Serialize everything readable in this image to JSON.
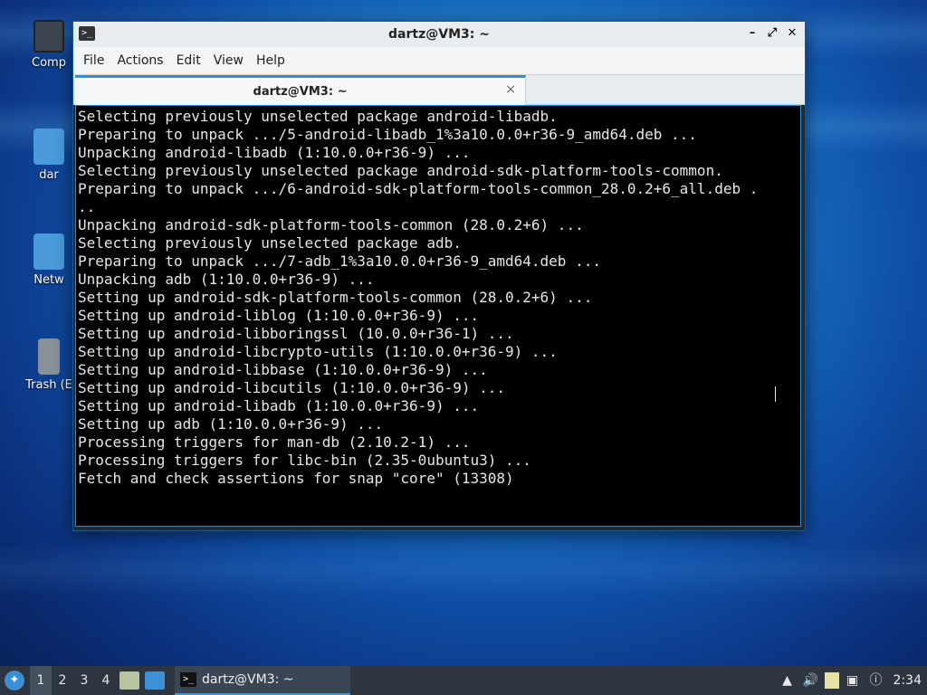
{
  "desktop": {
    "icons": [
      {
        "label": "Comp"
      },
      {
        "label": "dar"
      },
      {
        "label": "Netw"
      },
      {
        "label": "Trash (E"
      }
    ]
  },
  "window": {
    "title": "dartz@VM3: ~",
    "icon": "terminal-icon",
    "controls": {
      "minimize": "–",
      "maximize": "⤢",
      "close": "✕"
    },
    "menu": [
      "File",
      "Actions",
      "Edit",
      "View",
      "Help"
    ],
    "tab": {
      "label": "dartz@VM3: ~",
      "close": "×"
    },
    "terminal_lines": [
      "Selecting previously unselected package android-libadb.",
      "Preparing to unpack .../5-android-libadb_1%3a10.0.0+r36-9_amd64.deb ...",
      "Unpacking android-libadb (1:10.0.0+r36-9) ...",
      "Selecting previously unselected package android-sdk-platform-tools-common.",
      "Preparing to unpack .../6-android-sdk-platform-tools-common_28.0.2+6_all.deb .",
      "..",
      "Unpacking android-sdk-platform-tools-common (28.0.2+6) ...",
      "Selecting previously unselected package adb.",
      "Preparing to unpack .../7-adb_1%3a10.0.0+r36-9_amd64.deb ...",
      "Unpacking adb (1:10.0.0+r36-9) ...",
      "Setting up android-sdk-platform-tools-common (28.0.2+6) ...",
      "Setting up android-liblog (1:10.0.0+r36-9) ...",
      "Setting up android-libboringssl (10.0.0+r36-1) ...",
      "Setting up android-libcrypto-utils (1:10.0.0+r36-9) ...",
      "Setting up android-libbase (1:10.0.0+r36-9) ...",
      "Setting up android-libcutils (1:10.0.0+r36-9) ...",
      "Setting up android-libadb (1:10.0.0+r36-9) ...",
      "Setting up adb (1:10.0.0+r36-9) ...",
      "Processing triggers for man-db (2.10.2-1) ...",
      "Processing triggers for libc-bin (2.35-0ubuntu3) ...",
      "Fetch and check assertions for snap \"core\" (13308)"
    ]
  },
  "taskbar": {
    "workspaces": [
      "1",
      "2",
      "3",
      "4"
    ],
    "active_workspace": "1",
    "task_label": "dartz@VM3: ~",
    "clock": "2:34"
  },
  "colors": {
    "accent": "#2f8fd8",
    "terminal_bg": "#000000",
    "terminal_fg": "#e6e6e6",
    "taskbar_bg": "#2c3540"
  }
}
